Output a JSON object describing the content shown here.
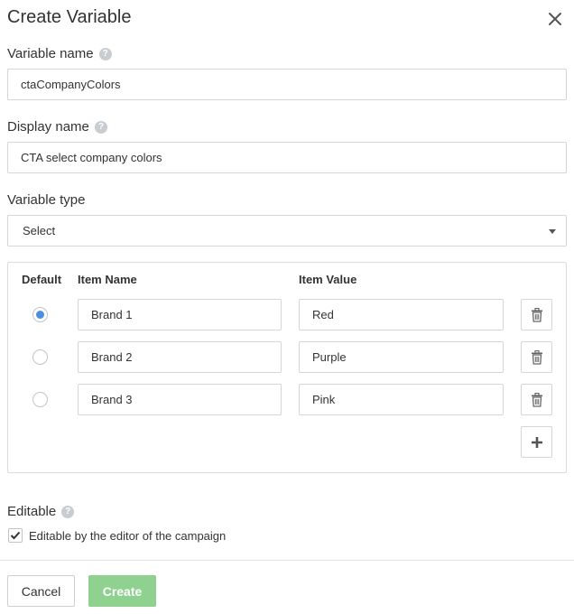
{
  "dialog": {
    "title": "Create Variable"
  },
  "variable_name": {
    "label": "Variable name",
    "value": "ctaCompanyColors"
  },
  "display_name": {
    "label": "Display name",
    "value": "CTA select company colors"
  },
  "variable_type": {
    "label": "Variable type",
    "selected": "Select"
  },
  "items_table": {
    "headers": {
      "default": "Default",
      "item_name": "Item Name",
      "item_value": "Item Value"
    },
    "rows": [
      {
        "name": "Brand 1",
        "value": "Red",
        "is_default": true
      },
      {
        "name": "Brand 2",
        "value": "Purple",
        "is_default": false
      },
      {
        "name": "Brand 3",
        "value": "Pink",
        "is_default": false
      }
    ]
  },
  "editable": {
    "label": "Editable",
    "checkbox_label": "Editable by the editor of the campaign",
    "checked": true
  },
  "buttons": {
    "cancel": "Cancel",
    "create": "Create"
  },
  "colors": {
    "radio_selected": "#4a8fe0",
    "create_button": "#8fd18f",
    "help_icon": "#c8cdd2",
    "border": "#d6d6d6"
  },
  "icons": {
    "close": "close-icon",
    "help": "help-icon",
    "delete": "trash-icon",
    "add": "plus-icon",
    "dropdown": "caret-down-icon",
    "check": "checkmark-icon"
  }
}
